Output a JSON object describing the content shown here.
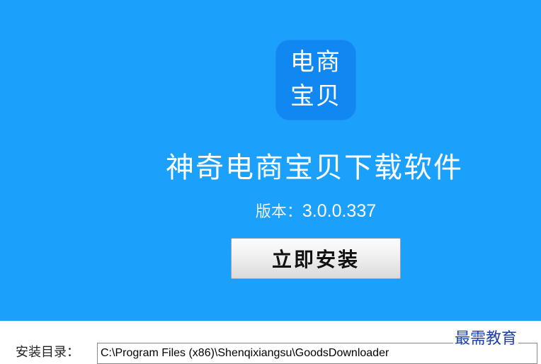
{
  "hero": {
    "app_icon": {
      "line1": "电商",
      "line2": "宝贝"
    },
    "product_title": "神奇电商宝贝下载软件",
    "version_label": "版本：",
    "version_value": "3.0.0.337",
    "install_button_label": "立即安装",
    "background_color": "#1ba0fb"
  },
  "install_dir": {
    "label": "安装目录：",
    "value": "C:\\Program Files (x86)\\Shenqixiangsu\\GoodsDownloader"
  },
  "watermark": "最需教育"
}
